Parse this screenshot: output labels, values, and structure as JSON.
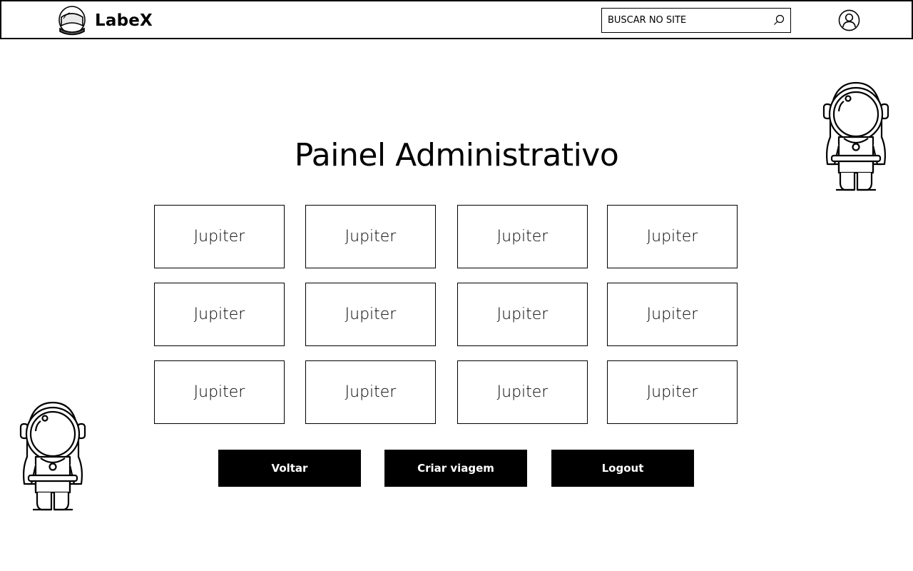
{
  "header": {
    "brand": "LabeX",
    "logo_icon": "astronaut-helmet-icon",
    "search": {
      "placeholder": "BUSCAR NO SITE",
      "value": "",
      "icon": "search-icon"
    },
    "user_icon": "user-account-icon"
  },
  "main": {
    "title": "Painel Administrativo",
    "trips": [
      {
        "label": "Jupiter"
      },
      {
        "label": "Jupiter"
      },
      {
        "label": "Jupiter"
      },
      {
        "label": "Jupiter"
      },
      {
        "label": "Jupiter"
      },
      {
        "label": "Jupiter"
      },
      {
        "label": "Jupiter"
      },
      {
        "label": "Jupiter"
      },
      {
        "label": "Jupiter"
      },
      {
        "label": "Jupiter"
      },
      {
        "label": "Jupiter"
      },
      {
        "label": "Jupiter"
      }
    ],
    "actions": {
      "back_label": "Voltar",
      "create_label": "Criar viagem",
      "logout_label": "Logout"
    }
  },
  "decor": {
    "astronaut_icon": "astronaut-illustration"
  },
  "colors": {
    "primary": "#000000",
    "background": "#ffffff",
    "button_text": "#ffffff"
  }
}
